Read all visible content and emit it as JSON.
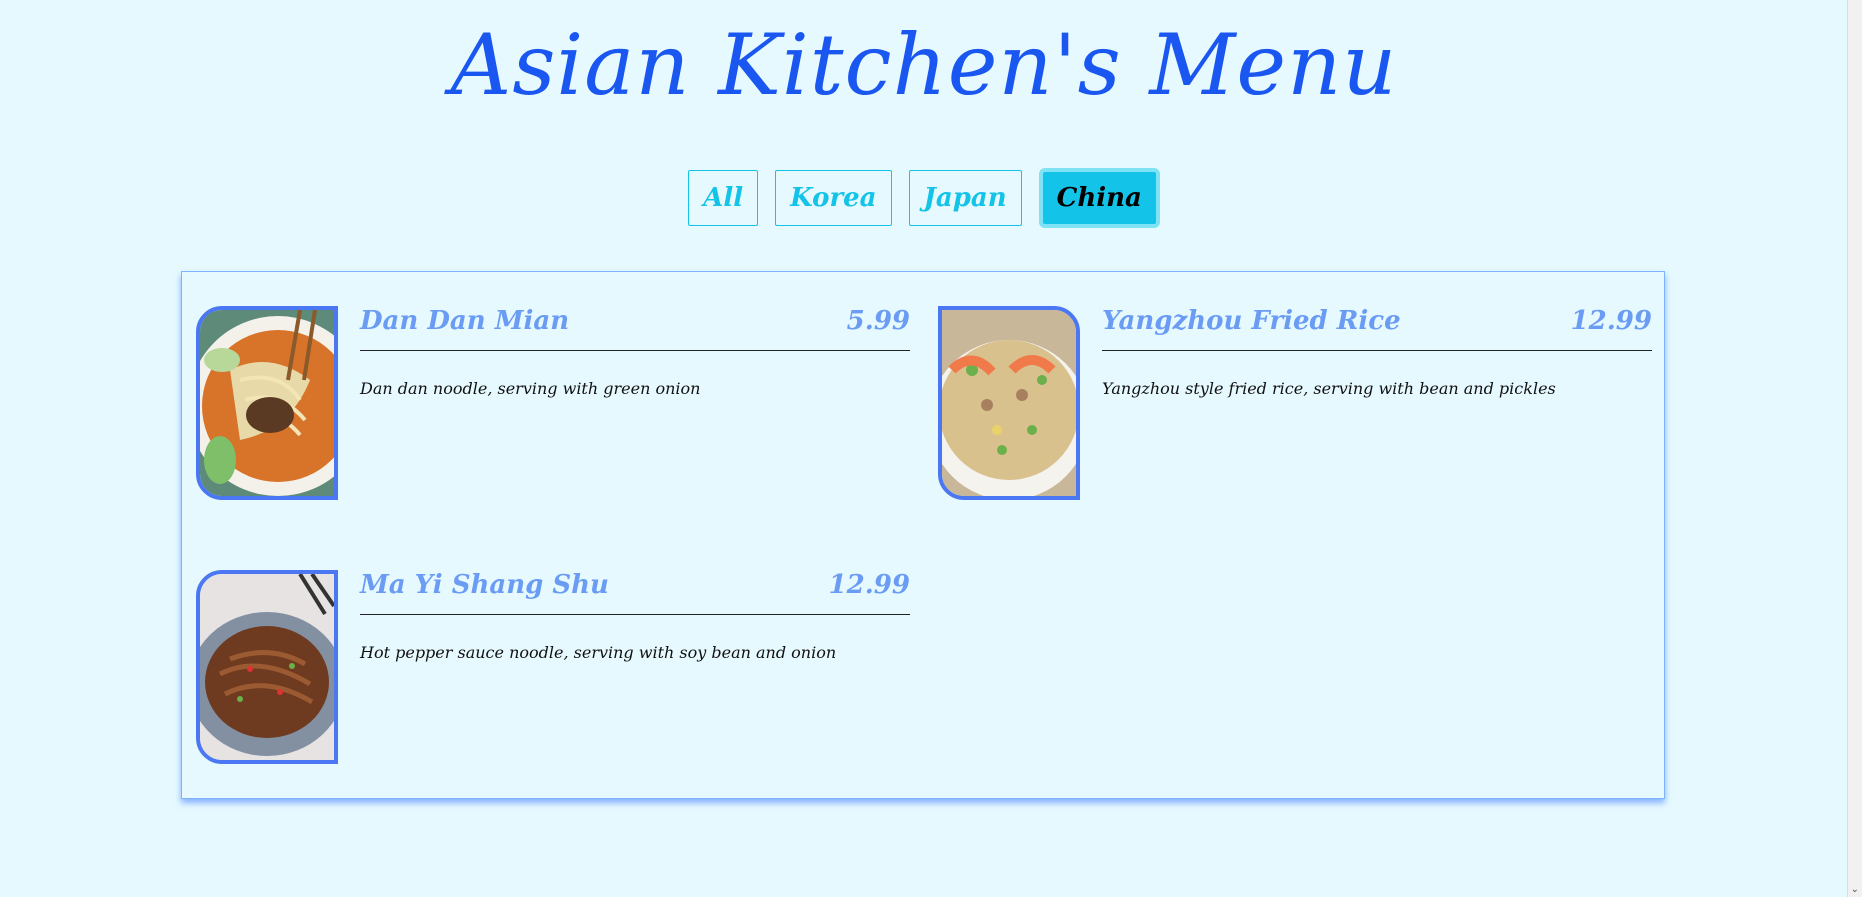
{
  "title": "Asian Kitchen's Menu",
  "filters": [
    {
      "label": "All",
      "active": false
    },
    {
      "label": "Korea",
      "active": false
    },
    {
      "label": "Japan",
      "active": false
    },
    {
      "label": "China",
      "active": true
    }
  ],
  "items": [
    {
      "name": "Dan Dan Mian",
      "price": "5.99",
      "desc": "Dan dan noodle, serving with green onion",
      "image": "dan-dan-mian-photo"
    },
    {
      "name": "Yangzhou Fried Rice",
      "price": "12.99",
      "desc": "Yangzhou style fried rice, serving with bean and pickles",
      "image": "yangzhou-fried-rice-photo"
    },
    {
      "name": "Ma Yi Shang Shu",
      "price": "12.99",
      "desc": "Hot pepper sauce noodle, serving with soy bean and onion",
      "image": "ma-yi-shang-shu-photo"
    }
  ],
  "colors": {
    "background": "#e6f9ff",
    "title": "#1a56f0",
    "accent": "#14c4e8",
    "item_heading": "#6a9cf4",
    "photo_border": "#4b78f2"
  }
}
